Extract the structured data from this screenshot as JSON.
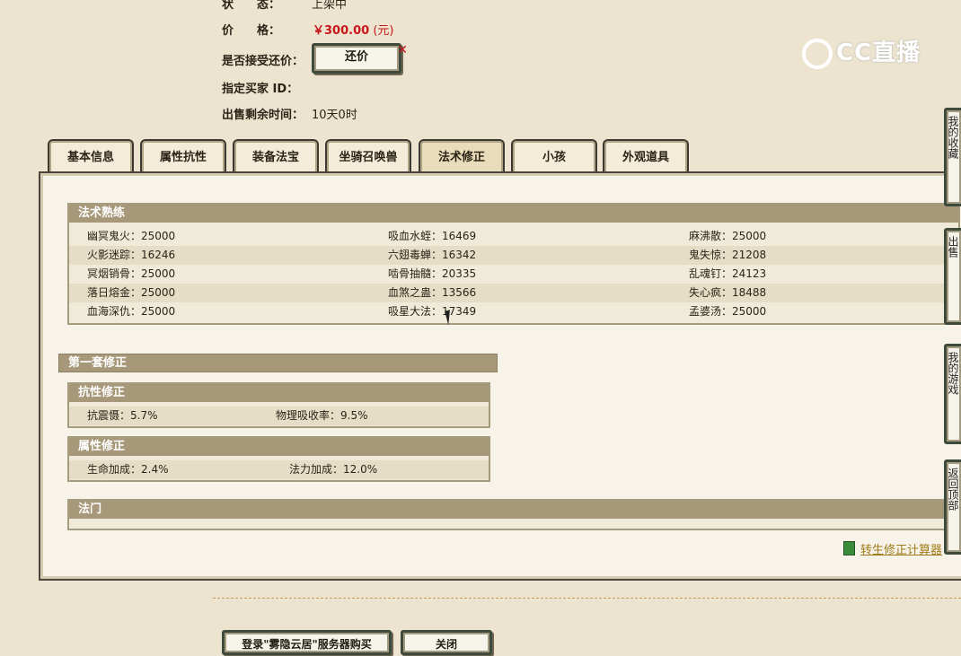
{
  "info": {
    "status_label": "状　　态：",
    "status_value": "上架中",
    "price_label": "价　　格：",
    "price_value": "￥300.00",
    "price_unit": "(元)",
    "counter_label": "是否接受还价：",
    "counter_button": "还价",
    "buyer_label": "指定买家 ID：",
    "remaining_label": "出售剩余时间：",
    "remaining_value": "10天0时"
  },
  "logo": {
    "text": "CC直播"
  },
  "tabs": [
    {
      "label": "基本信息"
    },
    {
      "label": "属性抗性"
    },
    {
      "label": "装备法宝"
    },
    {
      "label": "坐骑召唤兽"
    },
    {
      "label": "法术修正"
    },
    {
      "label": "小孩"
    },
    {
      "label": "外观道具"
    }
  ],
  "active_tab": "法术修正",
  "spell_mastery": {
    "title": "法术熟练",
    "rows": [
      [
        "幽冥鬼火：25000",
        "吸血水蛭：16469",
        "麻沸散：25000"
      ],
      [
        "火影迷踪：16246",
        "六翅毒蝉：16342",
        "鬼失惊：21208"
      ],
      [
        "冥烟销骨：25000",
        "啮骨抽髓：20335",
        "乱魂钉：24123"
      ],
      [
        "落日熔金：25000",
        "血煞之蛊：13566",
        "失心疯：18488"
      ],
      [
        "血海深仇：25000",
        "吸星大法：17349",
        "孟婆汤：25000"
      ]
    ]
  },
  "set1": {
    "title": "第一套修正",
    "resist": {
      "title": "抗性修正",
      "items": [
        "抗震慑：5.7%",
        "物理吸收率：9.5%"
      ]
    },
    "attr": {
      "title": "属性修正",
      "items": [
        "生命加成：2.4%",
        "法力加成：12.0%"
      ]
    }
  },
  "school": {
    "title": "法门"
  },
  "calc_link": "转生修正计算器",
  "bottom": {
    "login_button": "登录\"雾隐云居\"服务器购买",
    "close_button": "关闭"
  },
  "side_buttons": [
    {
      "label": "我的收藏"
    },
    {
      "label": "出售"
    },
    {
      "label": "我的游戏"
    },
    {
      "label": "返回顶部"
    }
  ]
}
